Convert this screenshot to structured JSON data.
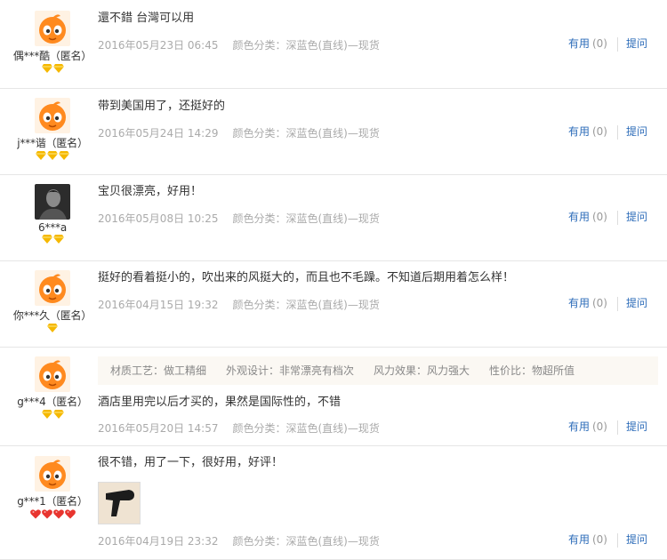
{
  "reviews": [
    {
      "user": "偶***酷（匿名）",
      "avatar": "mascot",
      "badge_count": 2,
      "badge_type": "yellow-diamond",
      "text": "還不錯 台灣可以用",
      "date": "2016年05月23日 06:45",
      "sku": "颜色分类：深蓝色(直线)—现货"
    },
    {
      "user": "j***谐（匿名）",
      "avatar": "mascot",
      "badge_count": 3,
      "badge_type": "yellow-diamond",
      "text": "带到美国用了，还挺好的",
      "date": "2016年05月24日 14:29",
      "sku": "颜色分类：深蓝色(直线)—现货"
    },
    {
      "user": "6***a",
      "avatar": "photo",
      "badge_count": 2,
      "badge_type": "yellow-diamond",
      "text": "宝贝很漂亮，好用！",
      "date": "2016年05月08日 10:25",
      "sku": "颜色分类：深蓝色(直线)—现货"
    },
    {
      "user": "你***久（匿名）",
      "avatar": "mascot",
      "badge_count": 1,
      "badge_type": "yellow-diamond",
      "text": "挺好的看着挺小的，吹出来的风挺大的，而且也不毛躁。不知道后期用着怎么样！",
      "date": "2016年04月15日 19:32",
      "sku": "颜色分类：深蓝色(直线)—现货"
    },
    {
      "user": "g***4（匿名）",
      "avatar": "mascot",
      "badge_count": 2,
      "badge_type": "yellow-diamond",
      "tags": [
        "材质工艺：做工精细",
        "外观设计：非常漂亮有档次",
        "风力效果：风力强大",
        "性价比：物超所值"
      ],
      "text": "酒店里用完以后才买的，果然是国际性的，不错",
      "date": "2016年05月20日 14:57",
      "sku": "颜色分类：深蓝色(直线)—现货"
    },
    {
      "user": "g***1（匿名）",
      "avatar": "mascot",
      "badge_count": 4,
      "badge_type": "red-heart",
      "text": "很不错，用了一下，很好用，好评！",
      "date": "2016年04月19日 23:32",
      "sku": "颜色分类：深蓝色(直线)—现货",
      "has_photo": true
    }
  ],
  "actions": {
    "useful_label": "有用",
    "useful_count": "(0)",
    "ask_label": "提问"
  },
  "colors": {
    "link": "#2d6cb9",
    "muted": "#aaaaaa",
    "diamond": "#f5b800",
    "heart": "#e8352f",
    "mascot": "#ff8a1f"
  }
}
